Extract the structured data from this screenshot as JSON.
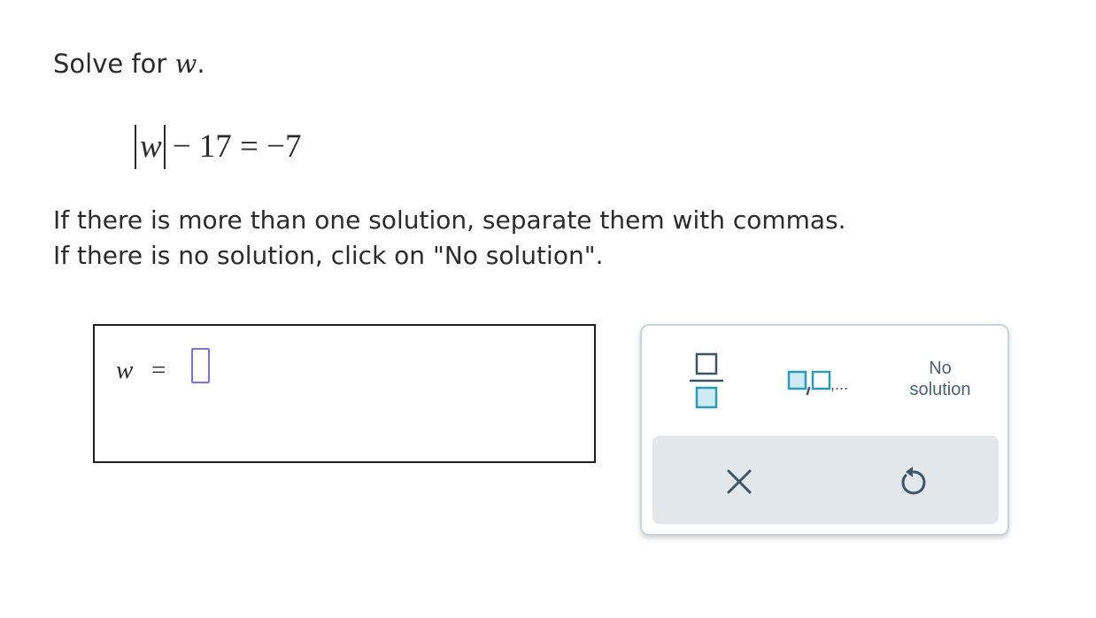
{
  "problem": {
    "prompt_text": "Solve for ",
    "variable": "w",
    "prompt_period": ".",
    "equation": {
      "abs_variable": "w",
      "rest": "− 17 = −7"
    },
    "instructions": [
      "If there is more than one solution, separate them with commas.",
      "If there is no solution, click on \"No solution\"."
    ]
  },
  "answer": {
    "variable": "w",
    "equals": "=",
    "value": ""
  },
  "keypad": {
    "fraction_icon": "fraction-icon",
    "list_icon": "comma-list-icon",
    "list_suffix": ",...",
    "no_solution_line1": "No",
    "no_solution_line2": "solution",
    "clear_icon": "close-icon",
    "undo_icon": "undo-icon"
  },
  "colors": {
    "accent_slot": "#7b6ff0",
    "keypad_icon": "#2a9bb8",
    "keypad_icon_fill": "#cfeaf2",
    "keypad_bottom": "#e1e7ea",
    "action_icon": "#3d5566"
  }
}
